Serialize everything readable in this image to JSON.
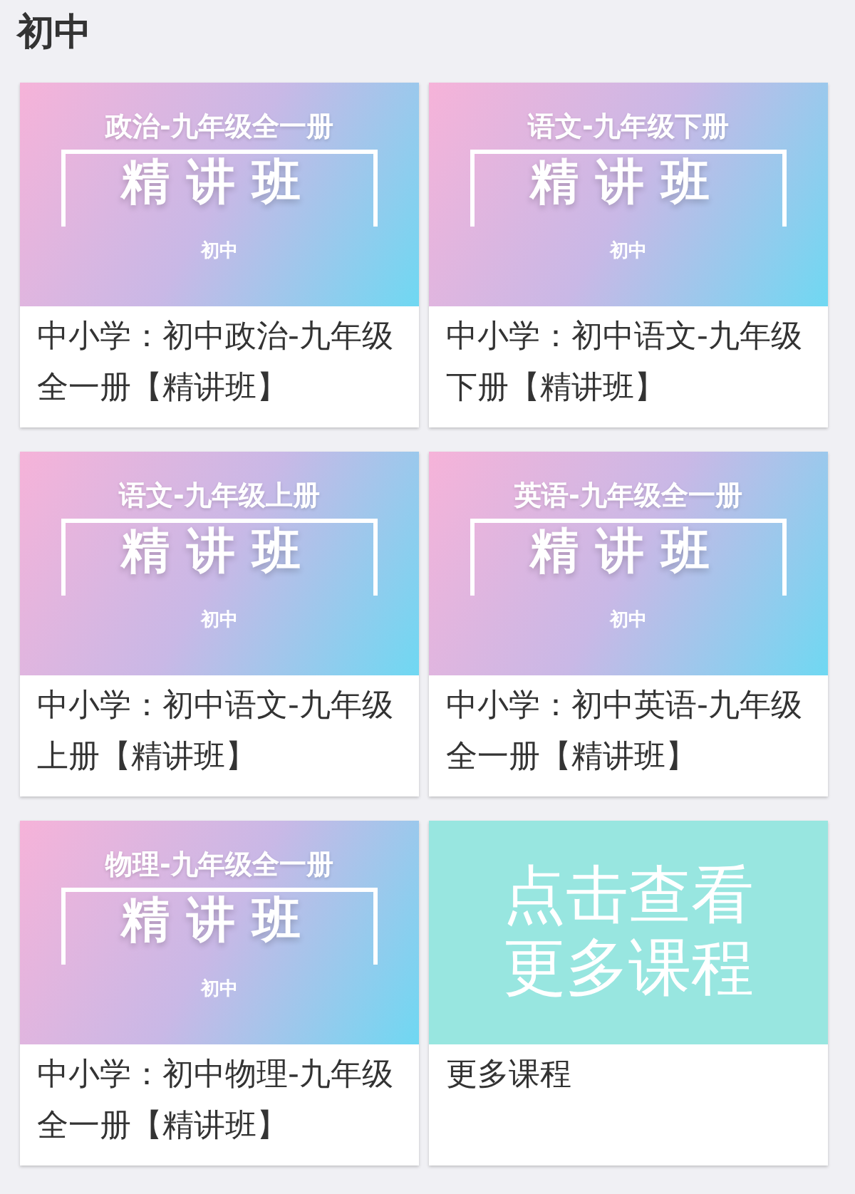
{
  "section_title": "初中",
  "courses": [
    {
      "kind": "course",
      "cover": {
        "subject": "政治-九年级全一册",
        "badge": "精讲班",
        "grade": "初中"
      },
      "caption": "中小学：初中政治-九年级全一册【精讲班】"
    },
    {
      "kind": "course",
      "cover": {
        "subject": "语文-九年级下册",
        "badge": "精讲班",
        "grade": "初中"
      },
      "caption": "中小学：初中语文-九年级下册【精讲班】"
    },
    {
      "kind": "course",
      "cover": {
        "subject": "语文-九年级上册",
        "badge": "精讲班",
        "grade": "初中"
      },
      "caption": "中小学：初中语文-九年级上册【精讲班】"
    },
    {
      "kind": "course",
      "cover": {
        "subject": "英语-九年级全一册",
        "badge": "精讲班",
        "grade": "初中"
      },
      "caption": "中小学：初中英语-九年级全一册【精讲班】"
    },
    {
      "kind": "course",
      "cover": {
        "subject": "物理-九年级全一册",
        "badge": "精讲班",
        "grade": "初中"
      },
      "caption": "中小学：初中物理-九年级全一册【精讲班】"
    },
    {
      "kind": "more",
      "cover": {
        "lines": [
          "点击查看",
          "更多课程"
        ]
      },
      "caption": "更多课程"
    }
  ]
}
